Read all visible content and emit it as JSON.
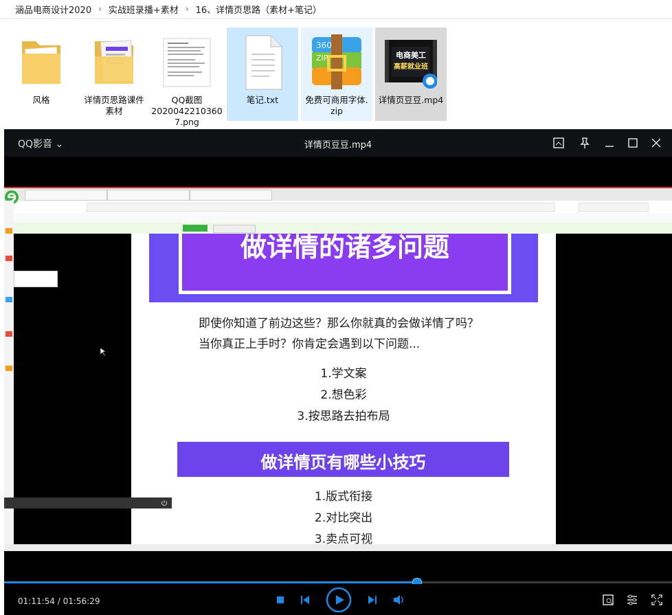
{
  "breadcrumb": [
    "涵品电商设计2020",
    "实战班录播+素材",
    "16、详情页思路（素材+笔记）"
  ],
  "breadcrumb_sep": "›",
  "files": [
    {
      "name": "风格",
      "type": "folder"
    },
    {
      "name": "详情页思路课件素材",
      "type": "folder"
    },
    {
      "name": "QQ截图20200422103607.png",
      "type": "image"
    },
    {
      "name": "笔记.txt",
      "type": "text"
    },
    {
      "name": "免费可商用字体.zip",
      "type": "zip"
    },
    {
      "name": "详情页豆豆.mp4",
      "type": "video"
    }
  ],
  "file_labels": {
    "f0": [
      "风格"
    ],
    "f1": [
      "详情页思路课件",
      "素材"
    ],
    "f2": [
      "QQ截图",
      "2020042210360",
      "7.png"
    ],
    "f3": [
      "笔记.txt"
    ],
    "f4": [
      "免费可商用字体.",
      "zip"
    ],
    "f5": [
      "详情页豆豆.mp4"
    ]
  },
  "video_thumb_text": [
    "电商美工",
    "高薪就业班"
  ],
  "zip_icon_text": [
    "360",
    "ZIP"
  ],
  "player": {
    "app_name": "QQ影音",
    "title": "详情页豆豆.mp4",
    "time_current": "01:11:54",
    "time_total": "01:56:29",
    "progress": 0.617
  },
  "slide": {
    "hero_title": "做详情的诸多问题",
    "para1": "即使你知道了前边这些？那么你就真的会做详情了吗？",
    "para2": "当你真正上手时？你肯定会遇到以下问题...",
    "list1": [
      "1.学文案",
      "2.想色彩",
      "3.按思路去拍布局"
    ],
    "banner": "做详情页有哪些小技巧",
    "list2": [
      "1.版式衔接",
      "2.对比突出",
      "3.卖点可视"
    ]
  },
  "colors": {
    "accent": "#1e88e5",
    "hero": "#6b4ef2",
    "banner": "#6d44ec",
    "selected": "#cce8ff"
  }
}
